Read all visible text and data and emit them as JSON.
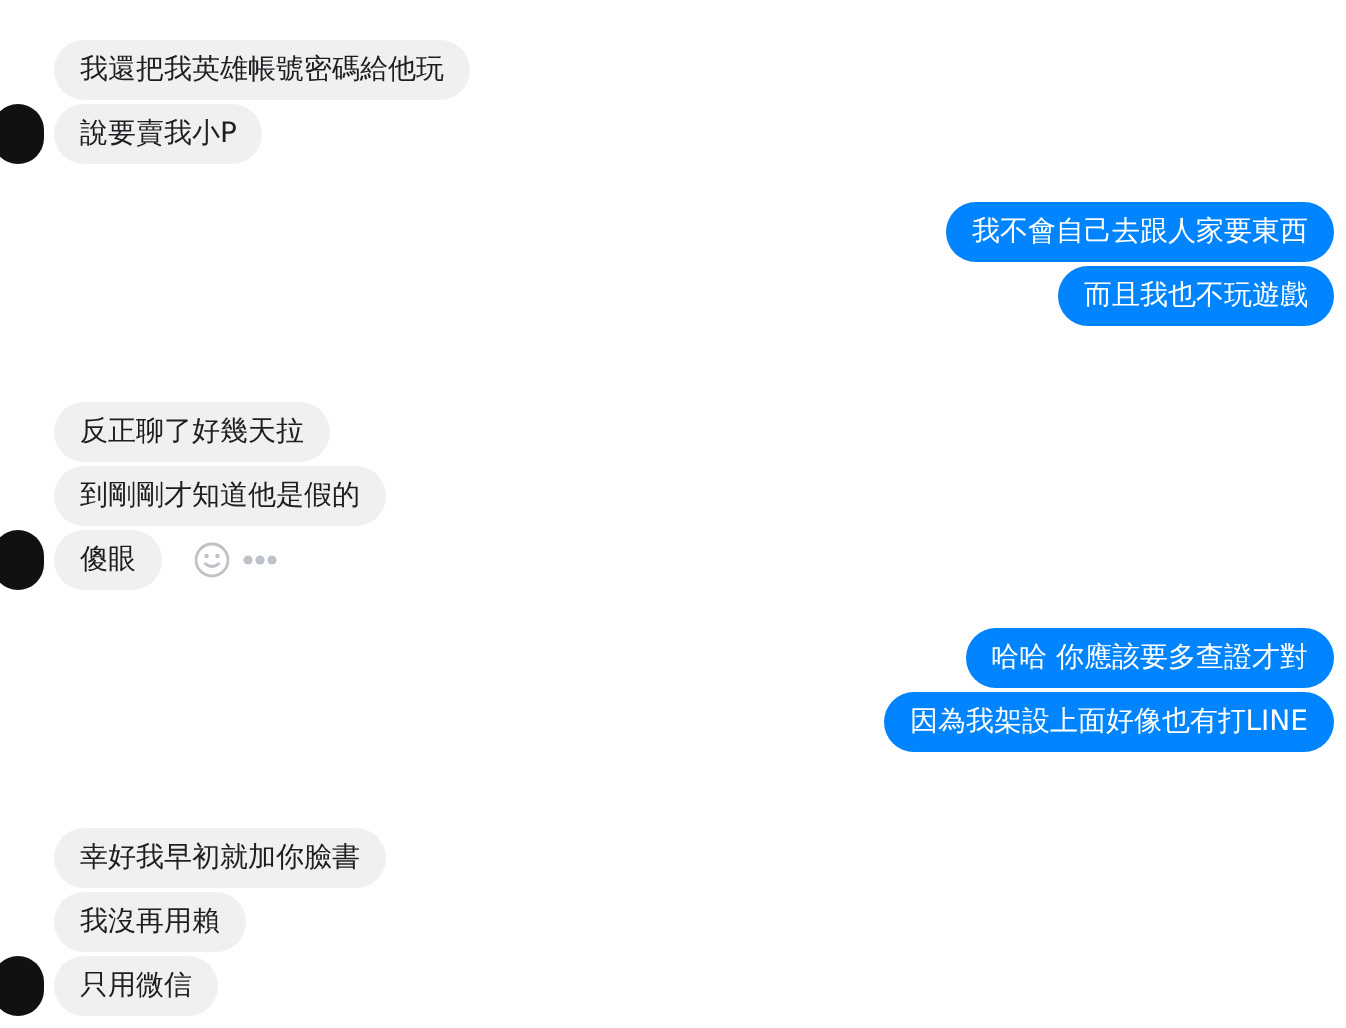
{
  "conversation": [
    {
      "kind": "incoming",
      "messages": [
        {
          "text": "我還把我英雄帳號密碼給他玩",
          "hover_actions": false
        },
        {
          "text": "說要賣我小P",
          "hover_actions": false
        }
      ]
    },
    {
      "kind": "outgoing",
      "messages": [
        {
          "text": "我不會自己去跟人家要東西",
          "hover_actions": false
        },
        {
          "text": "而且我也不玩遊戲",
          "hover_actions": false
        }
      ]
    },
    {
      "kind": "incoming",
      "messages": [
        {
          "text": "反正聊了好幾天拉",
          "hover_actions": false
        },
        {
          "text": "到剛剛才知道他是假的",
          "hover_actions": false
        },
        {
          "text": "傻眼",
          "hover_actions": true
        }
      ]
    },
    {
      "kind": "outgoing",
      "messages": [
        {
          "text": "哈哈 你應該要多查證才對",
          "hover_actions": false
        },
        {
          "text": "因為我架設上面好像也有打LINE",
          "hover_actions": false
        }
      ]
    },
    {
      "kind": "incoming",
      "messages": [
        {
          "text": "幸好我早初就加你臉書",
          "hover_actions": false
        },
        {
          "text": "我沒再用賴",
          "hover_actions": false
        },
        {
          "text": "只用微信",
          "hover_actions": false
        }
      ]
    }
  ]
}
